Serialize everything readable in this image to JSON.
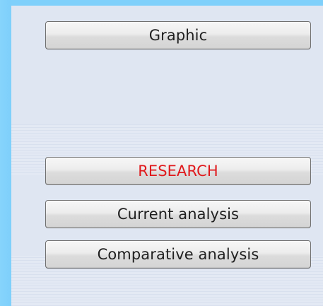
{
  "buttons": {
    "graphic": "Graphic",
    "research": "RESEARCH",
    "current_analysis": "Current analysis",
    "comparative_analysis": "Comparative analysis"
  },
  "colors": {
    "background_blue": "#7fd0fb",
    "panel": "#dfe6f2",
    "research_label": "#e0191c",
    "button_text": "#202020"
  }
}
